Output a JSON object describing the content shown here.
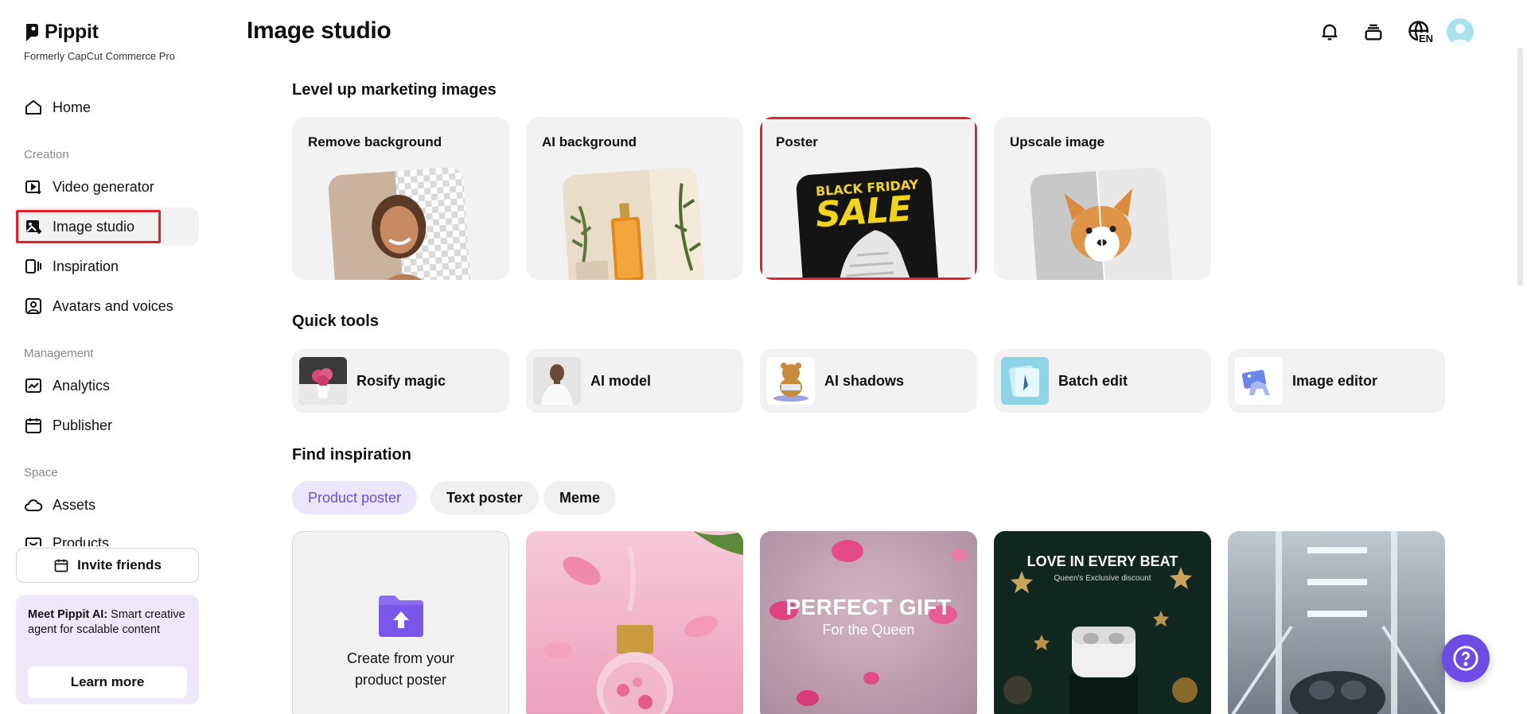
{
  "sidebar": {
    "logo_text": "Pippit",
    "logo_sub": "Formerly CapCut Commerce Pro",
    "home": "Home",
    "section_creation": "Creation",
    "video_generator": "Video generator",
    "image_studio": "Image studio",
    "inspiration": "Inspiration",
    "avatars_voices": "Avatars and voices",
    "section_management": "Management",
    "analytics": "Analytics",
    "publisher": "Publisher",
    "section_space": "Space",
    "assets": "Assets",
    "products": "Products",
    "invite_friends": "Invite friends",
    "promo_bold": "Meet Pippit AI:",
    "promo_text": " Smart creative agent for scalable content",
    "learn_more": "Learn more"
  },
  "header": {
    "title": "Image studio",
    "language": "EN"
  },
  "level_up": {
    "title": "Level up marketing images",
    "cards": [
      {
        "label": "Remove background"
      },
      {
        "label": "AI background"
      },
      {
        "label": "Poster",
        "poster_line1": "BLACK FRIDAY",
        "poster_line2": "SALE"
      },
      {
        "label": "Upscale image"
      }
    ]
  },
  "quick_tools": {
    "title": "Quick tools",
    "items": [
      {
        "label": "Rosify magic"
      },
      {
        "label": "AI model"
      },
      {
        "label": "AI shadows"
      },
      {
        "label": "Batch edit"
      },
      {
        "label": "Image editor"
      }
    ]
  },
  "inspiration": {
    "title": "Find inspiration",
    "tabs": [
      "Product poster",
      "Text poster",
      "Meme"
    ],
    "create_card": "Create from your product poster",
    "card2_title": "PERFECT GIFT",
    "card2_sub": "For the Queen",
    "card3_title": "LOVE IN EVERY BEAT",
    "card3_sub": "Queen's Exclusive discount"
  },
  "colors": {
    "accent": "#6d4ce6",
    "highlight": "#e0222a",
    "chip_active_bg": "#ece6fb",
    "card_bg": "#f2f2f2"
  }
}
